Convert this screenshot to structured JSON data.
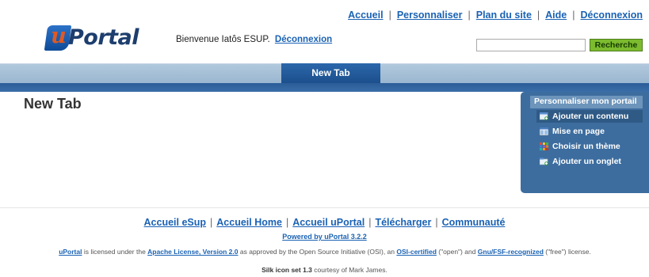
{
  "top_nav": {
    "items": [
      "Accueil",
      "Personnaliser",
      "Plan du site",
      "Aide",
      "Déconnexion"
    ],
    "separator": "|"
  },
  "logo": {
    "badge_letter": "u",
    "text": "Portal"
  },
  "welcome": {
    "text": "Bienvenue Iatôs ESUP.",
    "logout_link": "Déconnexion"
  },
  "search": {
    "value": "",
    "button_label": "Recherche"
  },
  "tabs": [
    {
      "label": "New Tab",
      "active": true
    }
  ],
  "main": {
    "title": "New Tab"
  },
  "personalize_panel": {
    "title": "Personnaliser mon portail",
    "items": [
      {
        "label": "Ajouter un contenu",
        "icon": "add-content-icon"
      },
      {
        "label": "Mise en page",
        "icon": "layout-icon"
      },
      {
        "label": "Choisir un thème",
        "icon": "theme-icon"
      },
      {
        "label": "Ajouter un onglet",
        "icon": "add-tab-icon"
      }
    ]
  },
  "footer": {
    "links": [
      "Accueil eSup",
      "Accueil Home",
      "Accueil uPortal",
      "Télécharger",
      "Communauté"
    ],
    "separator": "|",
    "powered_by": "Powered by uPortal 3.2.2",
    "license": {
      "product": "uPortal",
      "t1": " is licensed under the ",
      "license_name": "Apache License, Version 2.0",
      "t2": " as approved by the Open Source Initiative (OSI), an ",
      "osi": "OSI-certified",
      "t3": " (\"open\") and ",
      "gnu": "Gnu/FSF-recognized",
      "t4": " (\"free\") license."
    },
    "silk": {
      "name": "Silk icon set 1.3",
      "rest": " courtesy of Mark James."
    }
  },
  "colors": {
    "link": "#1a62b4",
    "tab_active": "#1c4f8c",
    "tabbar": "#9ab6d0",
    "panel": "#3d6d9f",
    "search_button": "#7cbb2e"
  }
}
